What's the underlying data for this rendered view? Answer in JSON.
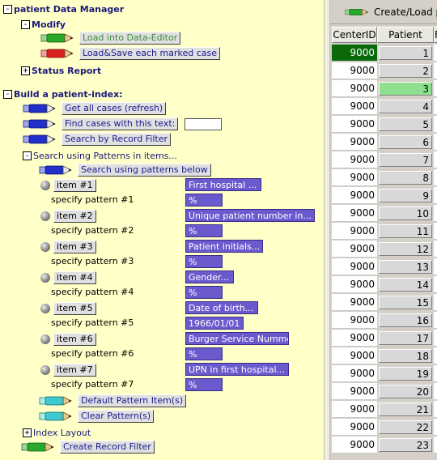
{
  "left": {
    "data_manager": {
      "title": "patient Data Manager",
      "modify_label": "Modify",
      "load_editor": "Load into Data-Editor",
      "load_save": "Load&Save each marked case",
      "status_report": "Status Report"
    },
    "build_index": {
      "title": "Build a patient-index:",
      "get_all": "Get all cases (refresh)",
      "find_cases": "Find cases with this text:",
      "search_filter": "Search by Record Filter",
      "search_patterns_label": "Search using Patterns in items...",
      "search_patterns_btn": "Search using patterns below",
      "items": [
        {
          "btn": "item #1",
          "field": "First hospital ...",
          "spec": "specify pattern #1",
          "pattern": "%"
        },
        {
          "btn": "item #2",
          "field": "Unique patient number in...",
          "spec": "specify pattern #2",
          "pattern": "%"
        },
        {
          "btn": "item #3",
          "field": "Patient initials...",
          "spec": "specify pattern #3",
          "pattern": "%"
        },
        {
          "btn": "item #4",
          "field": "Gender...",
          "spec": "specify pattern #4",
          "pattern": "%"
        },
        {
          "btn": "item #5",
          "field": "Date of birth...",
          "spec": "specify pattern #5",
          "pattern": "1966/01/01"
        },
        {
          "btn": "item #6",
          "field": "Burger Service Nummer...",
          "spec": "specify pattern #6",
          "pattern": "%"
        },
        {
          "btn": "item #7",
          "field": "UPN in first hospital...",
          "spec": "specify pattern #7",
          "pattern": "%"
        }
      ],
      "default_pattern": "Default Pattern Item(s)",
      "clear_pattern": "Clear Pattern(s)",
      "index_layout": "Index Layout",
      "create_filter": "Create Record Filter"
    }
  },
  "right": {
    "toolbar_label": "Create/Load pa",
    "columns": [
      "CenterID",
      "Patient",
      "F"
    ],
    "rows": [
      {
        "center": "9000",
        "patient": "1"
      },
      {
        "center": "9000",
        "patient": "2"
      },
      {
        "center": "9000",
        "patient": "3"
      },
      {
        "center": "9000",
        "patient": "4"
      },
      {
        "center": "9000",
        "patient": "5"
      },
      {
        "center": "9000",
        "patient": "6"
      },
      {
        "center": "9000",
        "patient": "7"
      },
      {
        "center": "9000",
        "patient": "8"
      },
      {
        "center": "9000",
        "patient": "9"
      },
      {
        "center": "9000",
        "patient": "10"
      },
      {
        "center": "9000",
        "patient": "11"
      },
      {
        "center": "9000",
        "patient": "12"
      },
      {
        "center": "9000",
        "patient": "13"
      },
      {
        "center": "9000",
        "patient": "14"
      },
      {
        "center": "9000",
        "patient": "15"
      },
      {
        "center": "9000",
        "patient": "16"
      },
      {
        "center": "9000",
        "patient": "17"
      },
      {
        "center": "9000",
        "patient": "18"
      },
      {
        "center": "9000",
        "patient": "19"
      },
      {
        "center": "9000",
        "patient": "20"
      },
      {
        "center": "9000",
        "patient": "21"
      },
      {
        "center": "9000",
        "patient": "22"
      },
      {
        "center": "9000",
        "patient": "23"
      }
    ]
  },
  "colors": {
    "panel_bg": "#ffffc8",
    "pattern_field": "#6a5acd",
    "selected_center": "#0a6a0a",
    "selected_patient": "#8ee08e"
  }
}
